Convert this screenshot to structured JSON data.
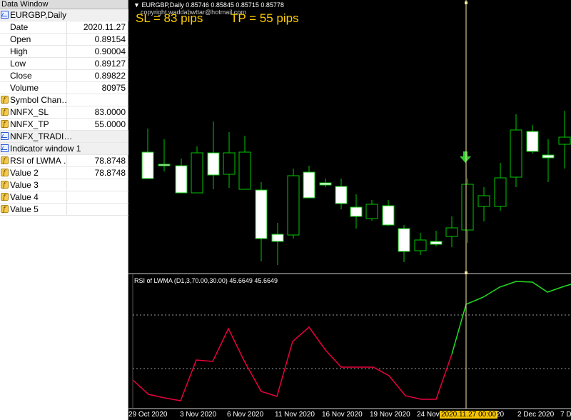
{
  "data_window": {
    "title": "Data Window",
    "rows": [
      {
        "type": "header",
        "icon": "chart-icon",
        "name": "EURGBP,Daily",
        "value": ""
      },
      {
        "type": "row",
        "icon": "",
        "name": "Date",
        "value": "2020.11.27"
      },
      {
        "type": "row",
        "icon": "",
        "name": "Open",
        "value": "0.89154"
      },
      {
        "type": "row",
        "icon": "",
        "name": "High",
        "value": "0.90004"
      },
      {
        "type": "row",
        "icon": "",
        "name": "Low",
        "value": "0.89127"
      },
      {
        "type": "row",
        "icon": "",
        "name": "Close",
        "value": "0.89822"
      },
      {
        "type": "row",
        "icon": "",
        "name": "Volume",
        "value": "80975"
      },
      {
        "type": "row",
        "icon": "indicator-icon",
        "name": "Symbol Chan…",
        "value": ""
      },
      {
        "type": "row",
        "icon": "indicator-icon",
        "name": "NNFX_SL",
        "value": "83.0000"
      },
      {
        "type": "row",
        "icon": "indicator-icon",
        "name": "NNFX_TP",
        "value": "55.0000"
      },
      {
        "type": "header",
        "icon": "chart-icon",
        "name": "NNFX_TRADI…",
        "value": ""
      },
      {
        "type": "header",
        "icon": "chart-icon",
        "name": "Indicator window 1",
        "value": ""
      },
      {
        "type": "row",
        "icon": "indicator-icon",
        "name": "RSI of LWMA …",
        "value": "78.8748"
      },
      {
        "type": "row",
        "icon": "indicator-icon",
        "name": "Value 2",
        "value": "78.8748"
      },
      {
        "type": "row",
        "icon": "indicator-icon",
        "name": "Value 3",
        "value": ""
      },
      {
        "type": "row",
        "icon": "indicator-icon",
        "name": "Value 4",
        "value": ""
      },
      {
        "type": "row",
        "icon": "indicator-icon",
        "name": "Value 5",
        "value": ""
      }
    ]
  },
  "chart": {
    "symbol_line": "EURGBP,Daily  0.85746 0.85845 0.85715 0.85778",
    "watermark": "copyright waddahwttar@hotmail.com",
    "sl_text": "SL = 83 pips",
    "tp_text": "TP = 55 pips",
    "rsi_title": "RSI of LWMA (D1,3,70.00,30.00) 45.6649 45.6649",
    "x_labels": [
      "29 Oct 2020",
      "3 Nov 2020",
      "6 Nov 2020",
      "11 Nov 2020",
      "16 Nov 2020",
      "19 Nov 2020",
      "24 Nov",
      "2020.11.27 00:00",
      "20",
      "2 Dec 2020",
      "7 De"
    ],
    "cursor_label_index": 7,
    "colors": {
      "background": "#000000",
      "candle_up_body": "#000000",
      "candle_down_body": "#ffffff",
      "wick": "#00c800",
      "rsi_low": "#e8003c",
      "rsi_high": "#22dd22",
      "levels": "#9a9a9a",
      "cursor": "#f7e7a0",
      "arrow": "#33cc33",
      "sltp": "#ffcc00"
    }
  }
}
